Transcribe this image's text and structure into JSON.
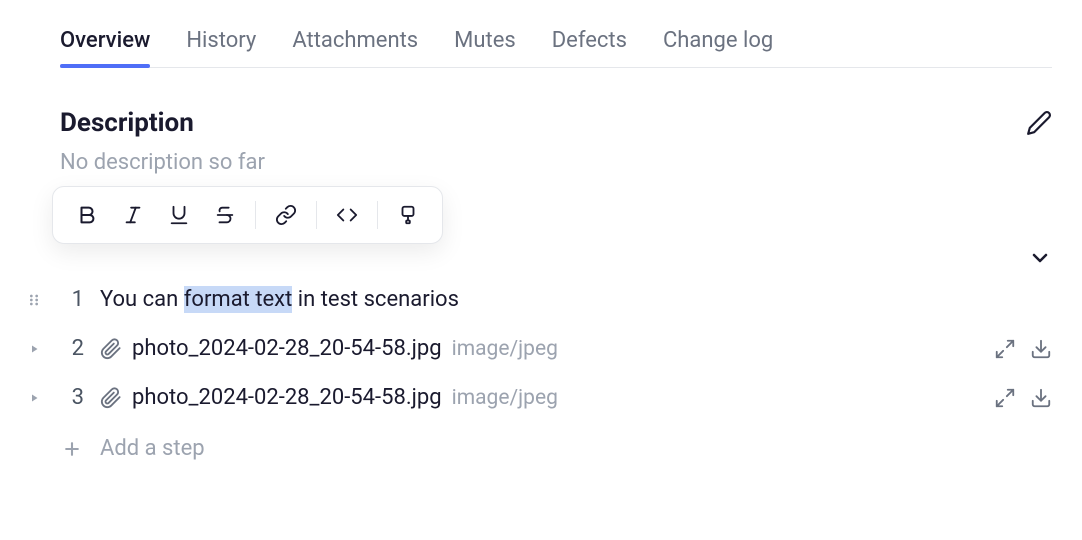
{
  "tabs": [
    "Overview",
    "History",
    "Attachments",
    "Mutes",
    "Defects",
    "Change log"
  ],
  "description": {
    "title": "Description",
    "placeholder": "No description so far"
  },
  "steps": [
    {
      "num": "1",
      "text_before": "You can ",
      "highlight": "format text",
      "text_after": " in test scenarios"
    },
    {
      "num": "2",
      "filename": "photo_2024-02-28_20-54-58.jpg",
      "mimetype": "image/jpeg"
    },
    {
      "num": "3",
      "filename": "photo_2024-02-28_20-54-58.jpg",
      "mimetype": "image/jpeg"
    }
  ],
  "add_step_label": "Add a step"
}
